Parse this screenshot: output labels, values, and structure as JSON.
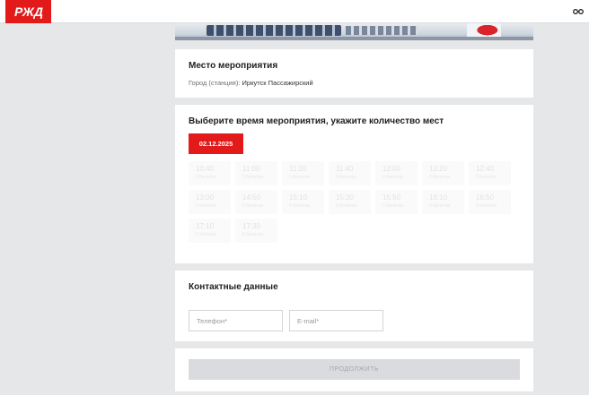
{
  "header": {
    "logo_text": "РЖД"
  },
  "place": {
    "title": "Место мероприятия",
    "city_label": "Город (станция):",
    "city_value": "Иркутск Пассажирский"
  },
  "schedule": {
    "title": "Выберите время мероприятия, укажите количество мест",
    "selected_date": "02.12.2025",
    "slots": [
      {
        "time": "10:40",
        "seats": "0 билетов"
      },
      {
        "time": "11:00",
        "seats": "0 билетов"
      },
      {
        "time": "11:20",
        "seats": "0 билетов"
      },
      {
        "time": "11:40",
        "seats": "0 билетов"
      },
      {
        "time": "12:00",
        "seats": "0 билетов"
      },
      {
        "time": "12:20",
        "seats": "0 билетов"
      },
      {
        "time": "12:40",
        "seats": "0 билетов"
      },
      {
        "time": "13:00",
        "seats": "0 билетов"
      },
      {
        "time": "14:50",
        "seats": "0 билетов"
      },
      {
        "time": "15:10",
        "seats": "0 билетов"
      },
      {
        "time": "15:30",
        "seats": "0 билетов"
      },
      {
        "time": "15:50",
        "seats": "0 билетов"
      },
      {
        "time": "16:10",
        "seats": "0 билетов"
      },
      {
        "time": "16:50",
        "seats": "0 билетов"
      },
      {
        "time": "17:10",
        "seats": "0 билетов"
      },
      {
        "time": "17:30",
        "seats": "0 билетов"
      }
    ]
  },
  "contacts": {
    "title": "Контактные данные",
    "phone_placeholder": "Телефон*",
    "email_placeholder": "E-mail*"
  },
  "submit": {
    "label": "ПРОДОЛЖИТЬ"
  },
  "colors": {
    "accent": "#e21a1a",
    "page_bg": "#e6e7e9",
    "disabled_btn": "#dadbde"
  }
}
